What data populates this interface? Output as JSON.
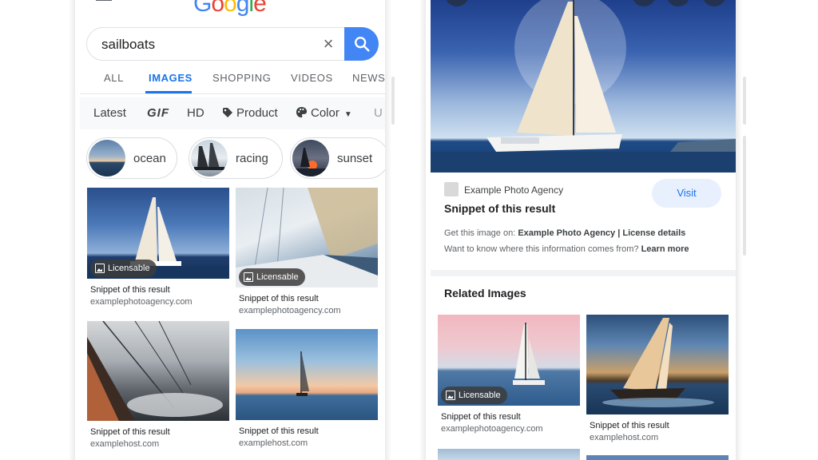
{
  "left": {
    "logo": [
      "G",
      "o",
      "o",
      "g",
      "l",
      "e"
    ],
    "logo_colors": [
      "#4285f4",
      "#ea4335",
      "#fbbc05",
      "#4285f4",
      "#34a853",
      "#ea4335"
    ],
    "search": {
      "query": "sailboats"
    },
    "tabs": [
      "ALL",
      "IMAGES",
      "SHOPPING",
      "VIDEOS",
      "NEWS"
    ],
    "active_tab": "IMAGES",
    "filters": {
      "latest": "Latest",
      "gif": "GIF",
      "hd": "HD",
      "product": "Product",
      "color": "Color",
      "more": "U"
    },
    "chips": [
      "ocean",
      "racing",
      "sunset"
    ],
    "results": [
      {
        "badge": "Licensable",
        "snippet": "Snippet of this result",
        "host": "examplephotoagency.com"
      },
      {
        "badge": "Licensable",
        "snippet": "Snippet of this result",
        "host": "examplephotoagency.com"
      },
      {
        "snippet": "Snippet of this result",
        "host": "examplehost.com"
      },
      {
        "snippet": "Snippet of this result",
        "host": "examplehost.com"
      }
    ]
  },
  "right": {
    "source_name": "Example Photo Agency",
    "visit_label": "Visit",
    "snippet_title": "Snippet of this result",
    "info_prefix": "Get this image on: ",
    "info_agency": "Example Photo Agency",
    "info_sep": " | ",
    "info_license": "License details",
    "info2_prefix": "Want to know where this information comes from? ",
    "info2_link": "Learn more",
    "related_title": "Related Images",
    "related": [
      {
        "badge": "Licensable",
        "snippet": "Snippet of this result",
        "host": "examplephotoagency.com"
      },
      {
        "snippet": "Snippet of this result",
        "host": "examplehost.com"
      }
    ]
  },
  "colors": {
    "accent": "#1a73e8",
    "search_button": "#4285f4"
  }
}
